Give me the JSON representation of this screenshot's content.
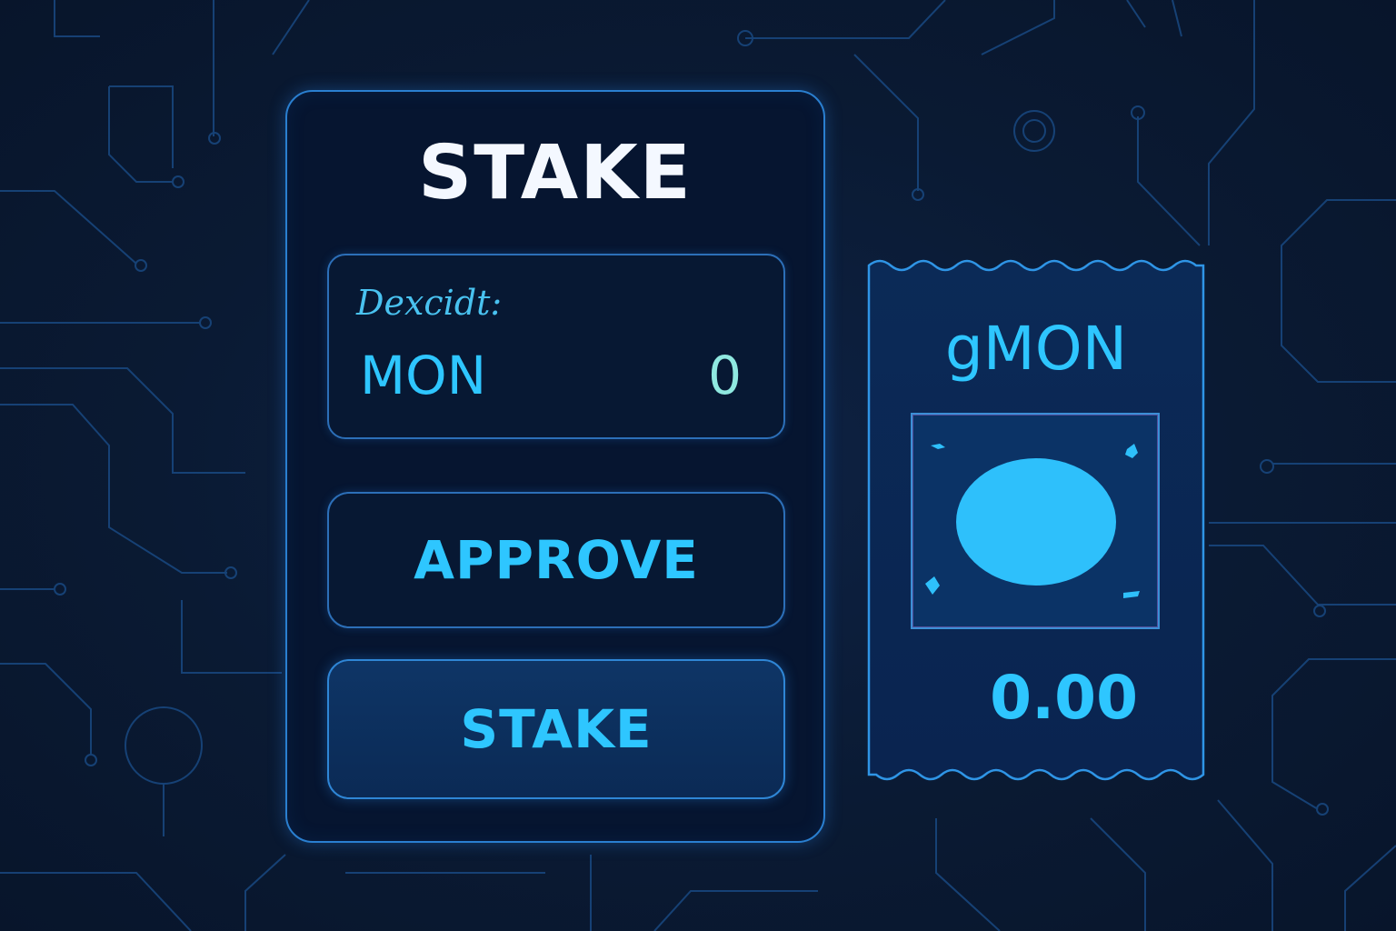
{
  "stake_panel": {
    "title": "STAKE",
    "deposit": {
      "label": "Dexcidt:",
      "token": "MON",
      "amount": "0"
    },
    "approve_label": "APPROVE",
    "stake_label": "STAKE"
  },
  "receipt": {
    "token": "gMON",
    "amount": "0.00",
    "image_icon": "coin-icon"
  },
  "colors": {
    "background": "#0a1a33",
    "accent": "#2ec6ff",
    "border": "#2a7fd0",
    "title": "#f4f8ff"
  }
}
